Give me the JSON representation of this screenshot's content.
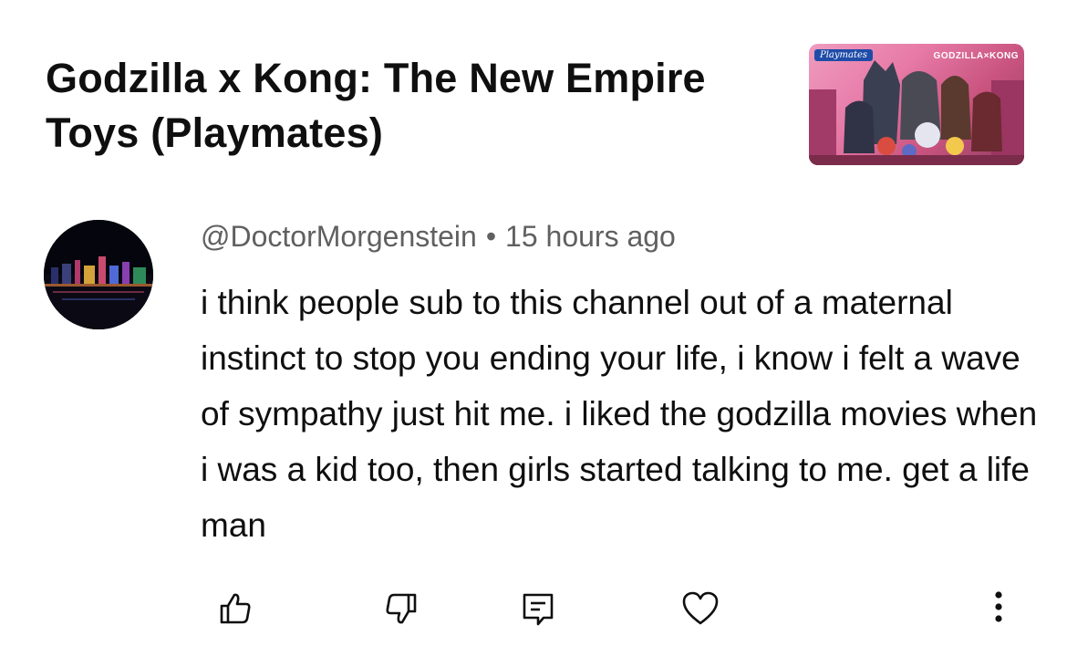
{
  "video": {
    "title": "Godzilla x Kong: The New Empire Toys (Playmates)",
    "thumbnail": {
      "brand_text": "Playmates",
      "logo_text": "GODZILLA×KONG"
    }
  },
  "comment": {
    "author": "@DoctorMorgenstein",
    "separator": "•",
    "timestamp": "15 hours ago",
    "text": "i think people sub to this channel out of a maternal instinct to stop you ending your life, i know i felt a wave of  sympathy just hit me. i liked the godzilla movies when i was a kid too, then girls started talking to me. get a life man"
  },
  "actions": {
    "icons": [
      "thumbs-up-icon",
      "thumbs-down-icon",
      "reply-icon",
      "heart-icon",
      "more-vertical-icon"
    ]
  },
  "colors": {
    "text_primary": "#0f0f0f",
    "text_secondary": "#606060",
    "background": "#ffffff",
    "icon": "#0f0f0f"
  }
}
